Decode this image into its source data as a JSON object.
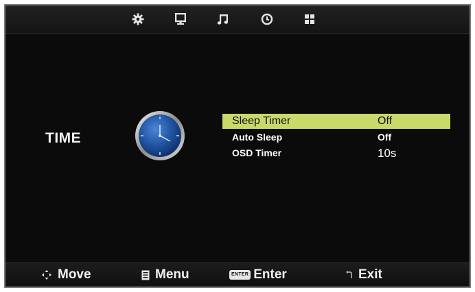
{
  "top_tabs": [
    {
      "icon": "gear-icon"
    },
    {
      "icon": "monitor-icon"
    },
    {
      "icon": "music-note-icon"
    },
    {
      "icon": "clock-icon"
    },
    {
      "icon": "grid-icon"
    }
  ],
  "section": {
    "title": "TIME",
    "icon": "clock-icon"
  },
  "menu": {
    "items": [
      {
        "label": "Sleep Timer",
        "value": "Off",
        "selected": true
      },
      {
        "label": "Auto Sleep",
        "value": "Off",
        "selected": false
      },
      {
        "label": "OSD Timer",
        "value": "10s",
        "selected": false
      }
    ]
  },
  "footer": {
    "move": "Move",
    "menu": "Menu",
    "enter_key": "ENTER",
    "enter": "Enter",
    "exit": "Exit"
  },
  "colors": {
    "background": "#0b0b0b",
    "highlight": "#c9d96a",
    "text": "#ffffff"
  }
}
